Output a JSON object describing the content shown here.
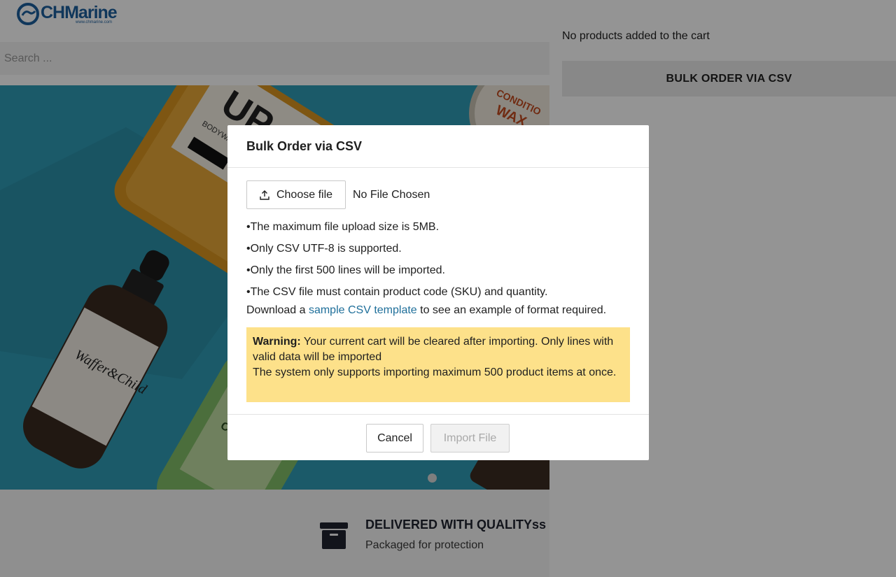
{
  "header": {
    "logo_text": "CHMarine",
    "logo_url": "www.chmarine.com",
    "search_placeholder": "Search ..."
  },
  "features": {
    "title": "DELIVERED WITH QUALITYss",
    "subtitle": "Packaged for protection",
    "icon": "archive-box-icon"
  },
  "cart": {
    "empty_text": "No products added to the cart",
    "bulk_button_label": "BULK ORDER VIA CSV"
  },
  "modal": {
    "title": "Bulk Order via CSV",
    "choose_button_label": "Choose file",
    "choose_button_icon": "upload-icon",
    "file_status": "No File Chosen",
    "rules": [
      "The maximum file upload size is 5MB.",
      "Only CSV UTF-8 is supported.",
      "Only the first 500 lines will be imported.",
      "The CSV file must contain product code (SKU) and quantity."
    ],
    "download_prefix": "Download a ",
    "download_link": "sample CSV template",
    "download_suffix": " to see an example of format required.",
    "warning_label": "Warning:",
    "warning_line1": " Your current cart will be cleared after importing. Only lines with valid data will be imported",
    "warning_line2": "The system only supports importing maximum 500 product items at once.",
    "cancel_label": "Cancel",
    "import_label": "Import File"
  },
  "colors": {
    "brand": "#1c5f9e",
    "hero_bg": "#2f9bb5",
    "link": "#1f6f9a",
    "warning_bg": "#fde18a"
  }
}
